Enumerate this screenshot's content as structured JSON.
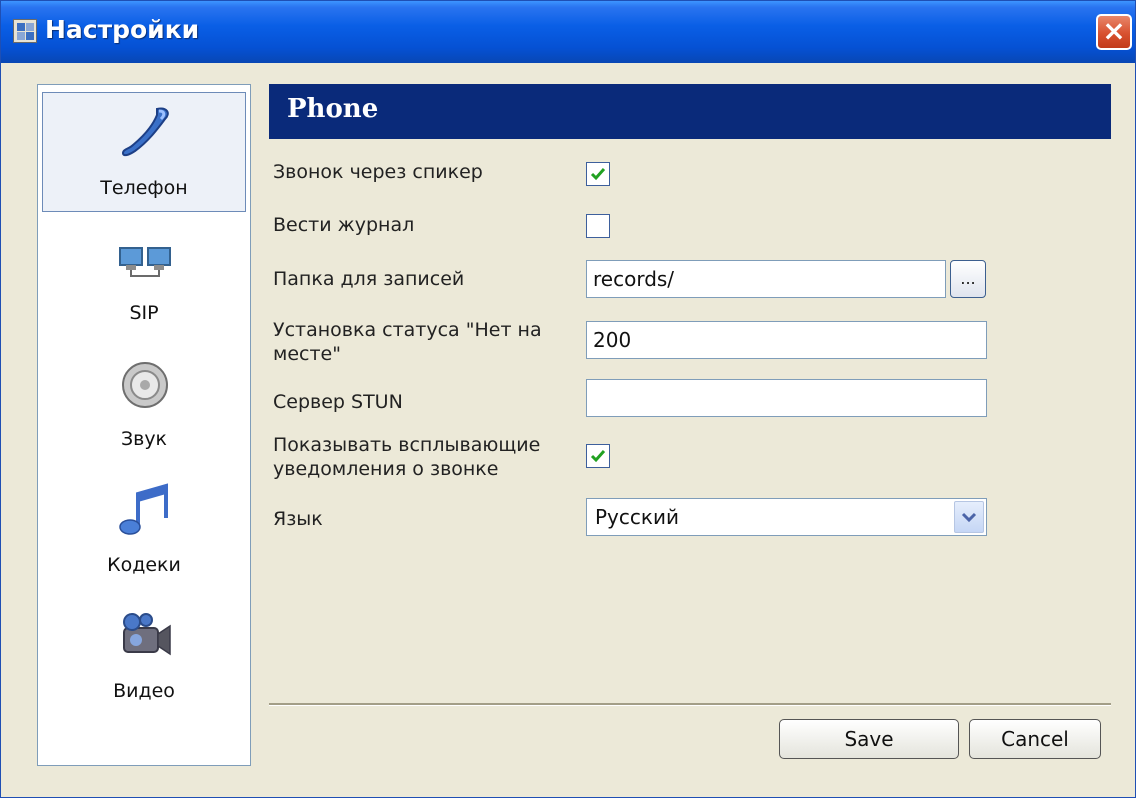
{
  "window": {
    "title": "Настройки"
  },
  "sidebar": {
    "items": [
      {
        "label": "Телефон",
        "icon": "phone-handset-icon",
        "active": true
      },
      {
        "label": "SIP",
        "icon": "computers-network-icon",
        "active": false
      },
      {
        "label": "Звук",
        "icon": "speaker-icon",
        "active": false
      },
      {
        "label": "Кодеки",
        "icon": "music-note-icon",
        "active": false
      },
      {
        "label": "Видео",
        "icon": "video-camera-icon",
        "active": false
      }
    ]
  },
  "panel": {
    "title": "Phone",
    "fields": {
      "speaker_call": {
        "label": "Звонок через спикер",
        "checked": true
      },
      "keep_log": {
        "label": "Вести журнал",
        "checked": false
      },
      "records_folder": {
        "label": "Папка для записей",
        "value": "records/",
        "browse_label": "..."
      },
      "away_status": {
        "label": "Установка статуса \"Нет на месте\"",
        "value": "200"
      },
      "stun_server": {
        "label": "Сервер STUN",
        "value": ""
      },
      "show_notifications": {
        "label": "Показывать всплывающие уведомления о звонке",
        "checked": true
      },
      "language": {
        "label": "Язык",
        "value": "Русский"
      }
    }
  },
  "buttons": {
    "save": "Save",
    "cancel": "Cancel"
  },
  "colors": {
    "title_bar": "#0551d4",
    "header_bar": "#0a2a7a",
    "window_bg": "#ece9d8",
    "check": "#21a121",
    "close": "#d8512f"
  }
}
